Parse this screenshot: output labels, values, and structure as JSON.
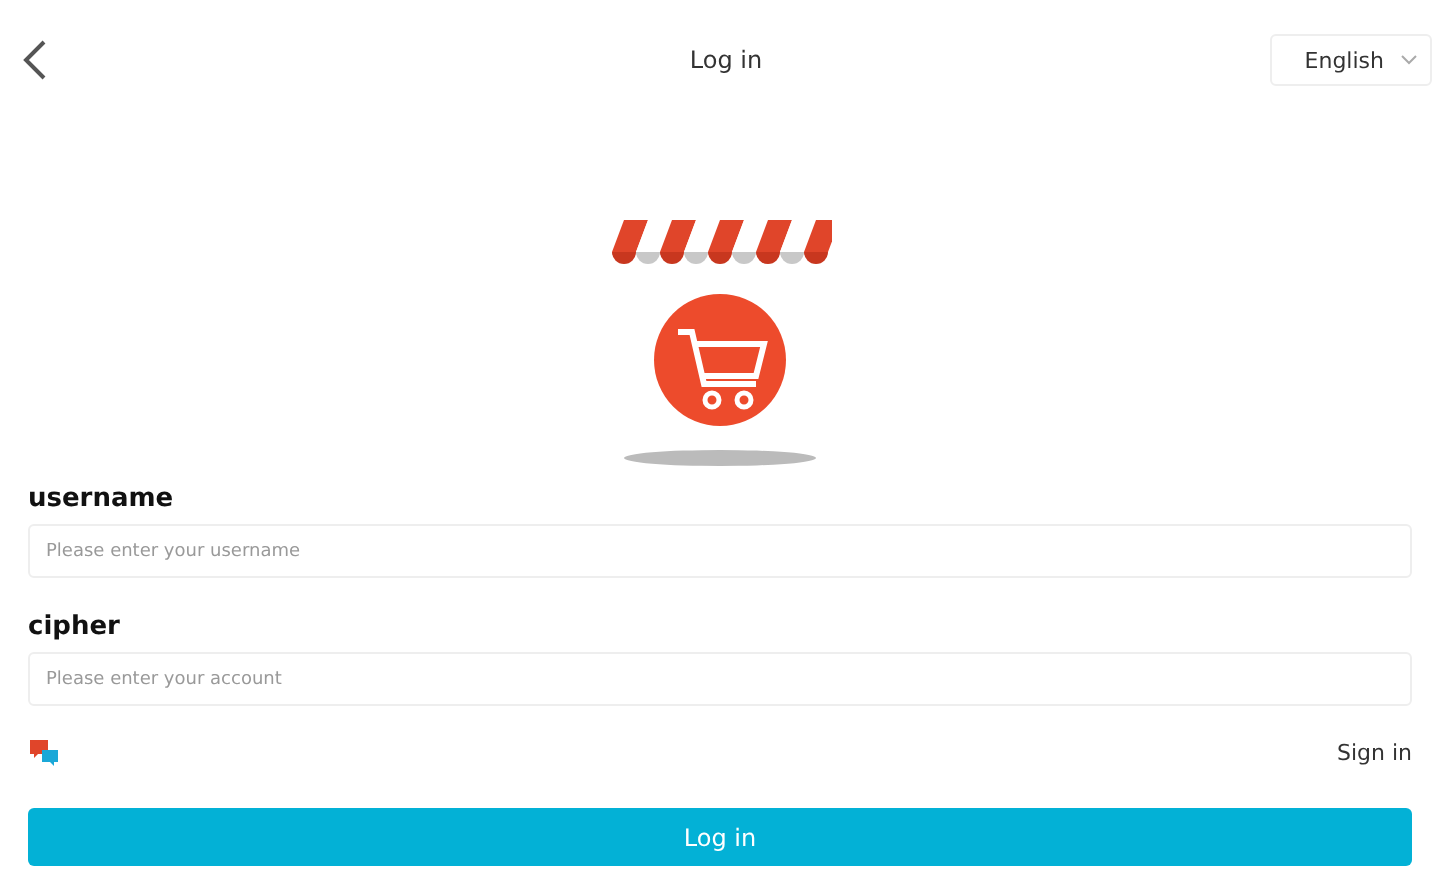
{
  "header": {
    "title": "Log in",
    "language": "English"
  },
  "fields": [
    {
      "label": "username",
      "placeholder": "Please enter your username"
    },
    {
      "label": "cipher",
      "placeholder": "Please enter your account"
    }
  ],
  "sign_in_link": "Sign in",
  "submit_button": "Log in"
}
